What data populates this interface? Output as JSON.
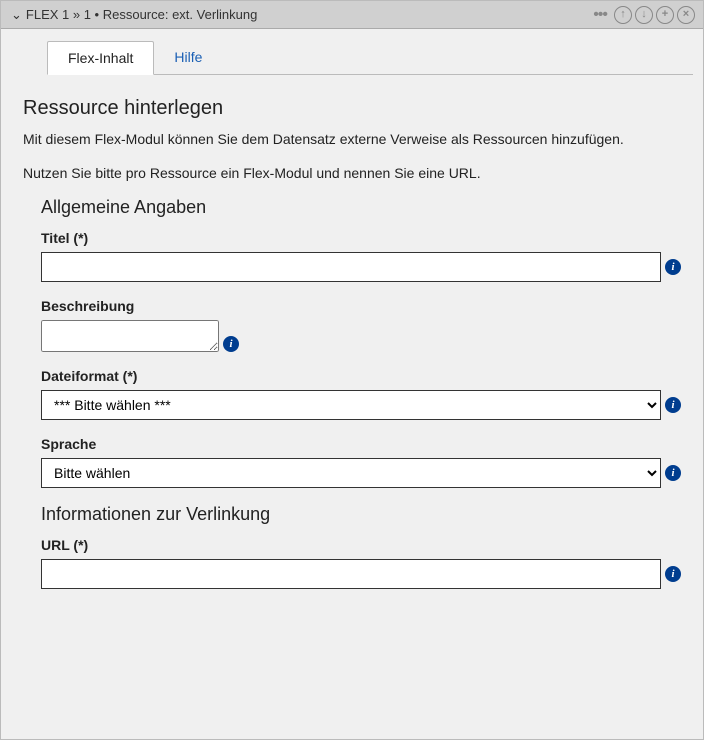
{
  "header": {
    "title": "FLEX 1 »  1 • Ressource: ext. Verlinkung"
  },
  "tabs": {
    "active": "Flex-Inhalt",
    "help": "Hilfe"
  },
  "content": {
    "heading": "Ressource hinterlegen",
    "desc1": "Mit diesem Flex-Modul können Sie dem Datensatz externe Verweise als Ressourcen hinzufügen.",
    "desc2": "Nutzen Sie bitte pro Ressource ein Flex-Modul und nennen Sie eine URL.",
    "group1": "Allgemeine Angaben",
    "titel_label": "Titel (*)",
    "titel_value": "",
    "besch_label": "Beschreibung",
    "besch_value": "",
    "format_label": "Dateiformat (*)",
    "format_selected": "*** Bitte wählen ***",
    "sprache_label": "Sprache",
    "sprache_selected": "Bitte wählen",
    "group2": "Informationen zur Verlinkung",
    "url_label": "URL (*)",
    "url_value": ""
  }
}
